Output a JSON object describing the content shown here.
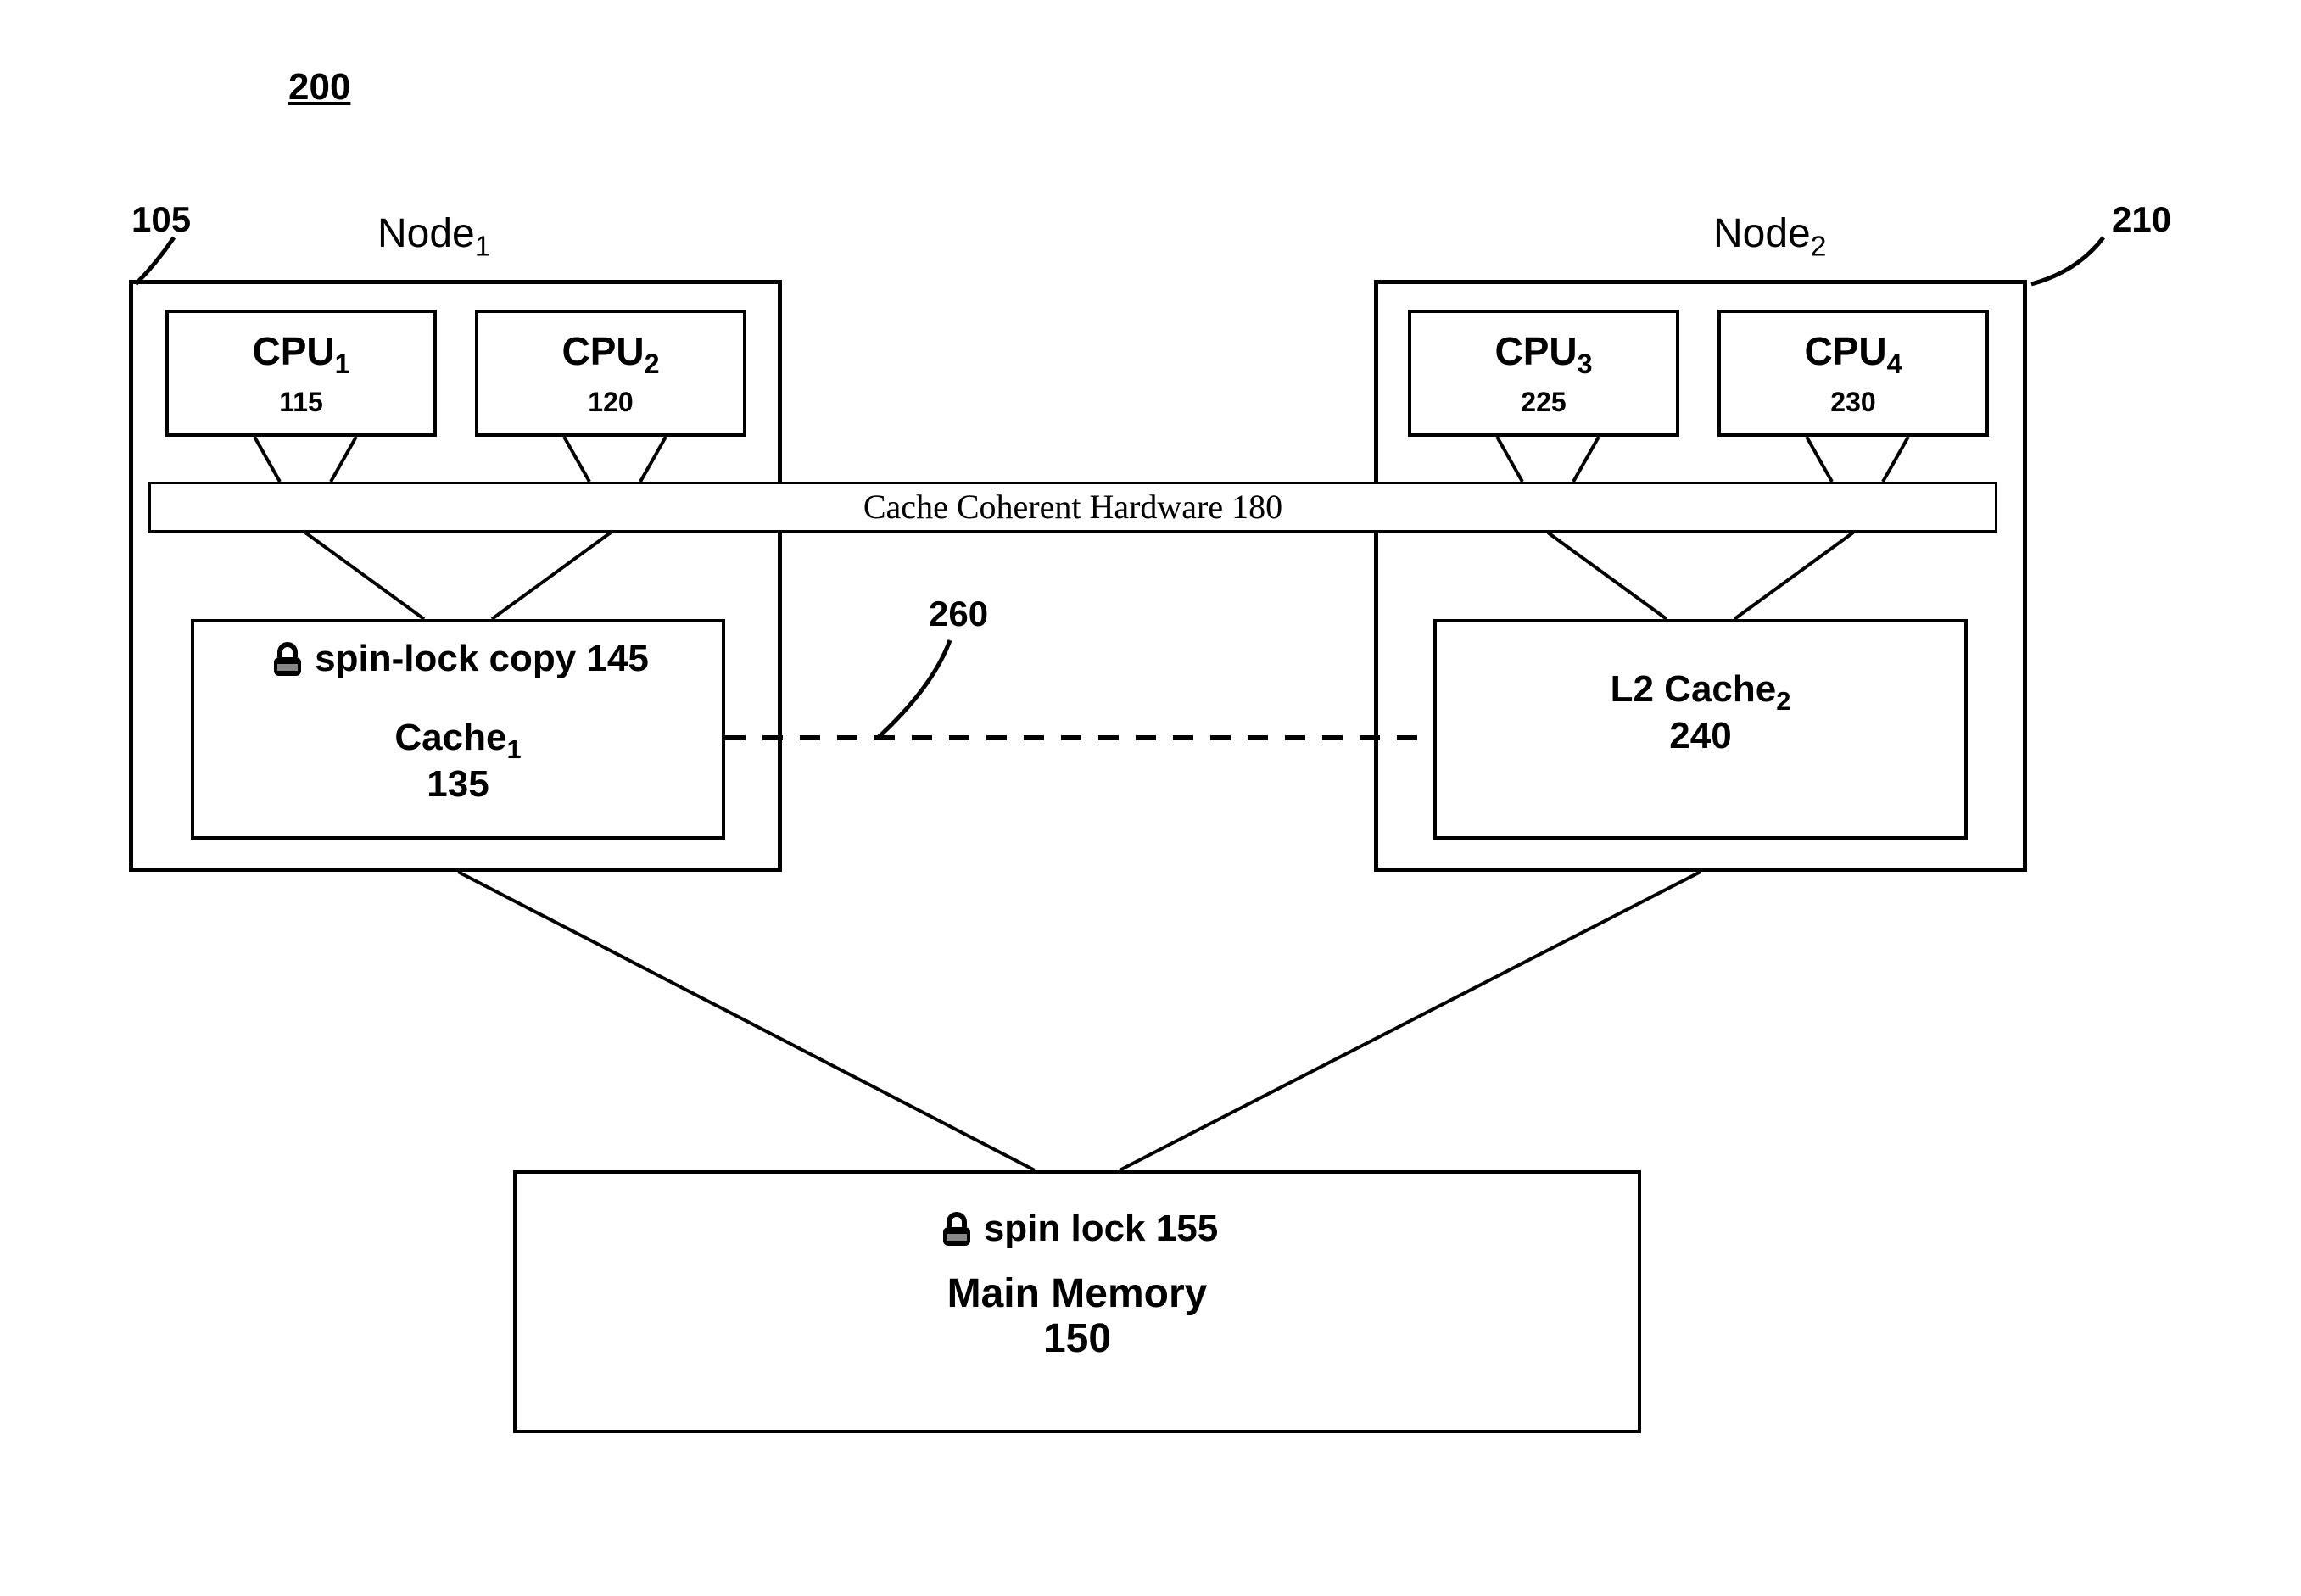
{
  "figure": {
    "number": "200"
  },
  "callouts": {
    "node1_ref": "105",
    "node2_ref": "210",
    "dashed_ref": "260"
  },
  "nodes": {
    "node1": {
      "title_prefix": "Node",
      "title_sub": "1",
      "cpu1": {
        "label_prefix": "CPU",
        "label_sub": "1",
        "ref": "115"
      },
      "cpu2": {
        "label_prefix": "CPU",
        "label_sub": "2",
        "ref": "120"
      },
      "cache": {
        "spin_lock_copy_label": "spin-lock copy 145",
        "name_prefix": "Cache",
        "name_sub": "1",
        "ref": "135"
      }
    },
    "node2": {
      "title_prefix": "Node",
      "title_sub": "2",
      "cpu3": {
        "label_prefix": "CPU",
        "label_sub": "3",
        "ref": "225"
      },
      "cpu4": {
        "label_prefix": "CPU",
        "label_sub": "4",
        "ref": "230"
      },
      "cache": {
        "name_prefix": "L2 Cache",
        "name_sub": "2",
        "ref": "240"
      }
    }
  },
  "cch": {
    "label": "Cache Coherent Hardware 180"
  },
  "memory": {
    "spin_lock_label": "spin lock 155",
    "name": "Main Memory",
    "ref": "150"
  },
  "icons": {
    "lock": "lock-icon"
  }
}
